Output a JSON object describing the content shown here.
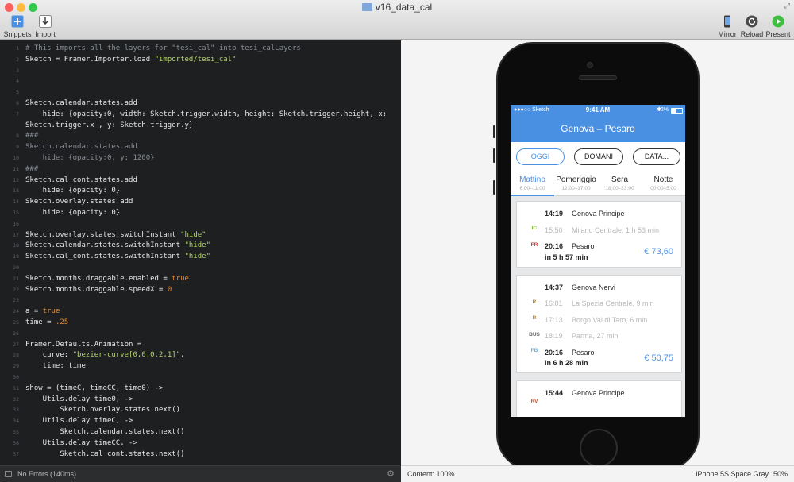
{
  "window": {
    "title": "v16_data_cal",
    "traffic_colors": [
      "#fc605c",
      "#fdbc40",
      "#34c84a"
    ]
  },
  "toolbar": {
    "snippets_label": "Snippets",
    "import_label": "Import",
    "mirror_label": "Mirror",
    "reload_label": "Reload",
    "present_label": "Present"
  },
  "editor": {
    "lines": [
      {
        "no": "1",
        "tokens": [
          {
            "t": "# This imports all the layers for \"tesi_cal\" into tesi_calLayers",
            "c": "cmt"
          }
        ]
      },
      {
        "no": "2",
        "tokens": [
          {
            "t": "Sketch = Framer.Importer.load ",
            "c": ""
          },
          {
            "t": "\"imported/tesi_cal\"",
            "c": "str"
          }
        ]
      },
      {
        "no": "3",
        "tokens": []
      },
      {
        "no": "4",
        "tokens": []
      },
      {
        "no": "5",
        "tokens": []
      },
      {
        "no": "6",
        "tokens": [
          {
            "t": "Sketch.calendar.states.add",
            "c": ""
          }
        ]
      },
      {
        "no": "7",
        "tokens": [
          {
            "t": "    hide: {opacity:0, width: Sketch.trigger.width, height: Sketch.trigger.height, x:",
            "c": ""
          }
        ]
      },
      {
        "no": "",
        "tokens": [
          {
            "t": "Sketch.trigger.x , y: Sketch.trigger.y}",
            "c": ""
          }
        ]
      },
      {
        "no": "8",
        "tokens": [
          {
            "t": "###",
            "c": "cmt"
          }
        ]
      },
      {
        "no": "9",
        "tokens": [
          {
            "t": "Sketch.calendar.states.add",
            "c": "cmt"
          }
        ]
      },
      {
        "no": "10",
        "tokens": [
          {
            "t": "    hide: {opacity:0, y: 1200}",
            "c": "cmt"
          }
        ]
      },
      {
        "no": "11",
        "tokens": [
          {
            "t": "###",
            "c": "cmt"
          }
        ]
      },
      {
        "no": "12",
        "tokens": [
          {
            "t": "Sketch.cal_cont.states.add",
            "c": ""
          }
        ]
      },
      {
        "no": "13",
        "tokens": [
          {
            "t": "    hide: {opacity: 0}",
            "c": ""
          }
        ]
      },
      {
        "no": "14",
        "tokens": [
          {
            "t": "Sketch.overlay.states.add",
            "c": ""
          }
        ]
      },
      {
        "no": "15",
        "tokens": [
          {
            "t": "    hide: {opacity: 0}",
            "c": ""
          }
        ]
      },
      {
        "no": "16",
        "tokens": []
      },
      {
        "no": "17",
        "tokens": [
          {
            "t": "Sketch.overlay.states.switchInstant ",
            "c": ""
          },
          {
            "t": "\"hide\"",
            "c": "str"
          }
        ]
      },
      {
        "no": "18",
        "tokens": [
          {
            "t": "Sketch.calendar.states.switchInstant ",
            "c": ""
          },
          {
            "t": "\"hide\"",
            "c": "str"
          }
        ]
      },
      {
        "no": "19",
        "tokens": [
          {
            "t": "Sketch.cal_cont.states.switchInstant ",
            "c": ""
          },
          {
            "t": "\"hide\"",
            "c": "str"
          }
        ]
      },
      {
        "no": "20",
        "tokens": []
      },
      {
        "no": "21",
        "tokens": [
          {
            "t": "Sketch.months.draggable.enabled = ",
            "c": ""
          },
          {
            "t": "true",
            "c": "kw"
          }
        ]
      },
      {
        "no": "22",
        "tokens": [
          {
            "t": "Sketch.months.draggable.speedX = ",
            "c": ""
          },
          {
            "t": "0",
            "c": "kw"
          }
        ]
      },
      {
        "no": "23",
        "tokens": []
      },
      {
        "no": "24",
        "tokens": [
          {
            "t": "a = ",
            "c": ""
          },
          {
            "t": "true",
            "c": "kw"
          }
        ]
      },
      {
        "no": "25",
        "tokens": [
          {
            "t": "time = ",
            "c": ""
          },
          {
            "t": ".25",
            "c": "kw"
          }
        ]
      },
      {
        "no": "26",
        "tokens": []
      },
      {
        "no": "27",
        "tokens": [
          {
            "t": "Framer.Defaults.Animation =",
            "c": ""
          }
        ]
      },
      {
        "no": "28",
        "tokens": [
          {
            "t": "    curve: ",
            "c": ""
          },
          {
            "t": "\"bezier-curve[0,0,0.2,1]\"",
            "c": "str"
          },
          {
            "t": ",",
            "c": ""
          }
        ]
      },
      {
        "no": "29",
        "tokens": [
          {
            "t": "    time: time",
            "c": ""
          }
        ]
      },
      {
        "no": "30",
        "tokens": []
      },
      {
        "no": "31",
        "tokens": [
          {
            "t": "show = (timeC, timeCC, time0) ->",
            "c": ""
          }
        ]
      },
      {
        "no": "32",
        "tokens": [
          {
            "t": "    Utils.delay time0, ->",
            "c": ""
          }
        ]
      },
      {
        "no": "33",
        "tokens": [
          {
            "t": "        Sketch.overlay.states.next()",
            "c": ""
          }
        ]
      },
      {
        "no": "34",
        "tokens": [
          {
            "t": "    Utils.delay timeC, ->",
            "c": ""
          }
        ]
      },
      {
        "no": "35",
        "tokens": [
          {
            "t": "        Sketch.calendar.states.next()",
            "c": ""
          }
        ]
      },
      {
        "no": "36",
        "tokens": [
          {
            "t": "    Utils.delay timeCC, ->",
            "c": ""
          }
        ]
      },
      {
        "no": "37",
        "tokens": [
          {
            "t": "        Sketch.cal_cont.states.next()",
            "c": ""
          }
        ]
      }
    ],
    "status": "No Errors (140ms)"
  },
  "preview": {
    "content_zoom": "Content: 100%",
    "device": "iPhone 5S Space Gray",
    "device_zoom": "50%"
  },
  "app": {
    "status_bar": {
      "carrier": "●●●○○ Sketch",
      "time": "9:41 AM",
      "battery": "42%"
    },
    "route_title": "Genova – Pesaro",
    "day_buttons": [
      "OGGI",
      "DOMANI",
      "DATA..."
    ],
    "time_tabs": [
      {
        "name": "Mattino",
        "time": "6:00–11:00"
      },
      {
        "name": "Pomeriggio",
        "time": "12:00–17:00"
      },
      {
        "name": "Sera",
        "time": "18:00–23:00"
      },
      {
        "name": "Notte",
        "time": "00:00–5:00"
      }
    ],
    "accent_color": "#4a90e2",
    "trips": [
      {
        "tags": [
          "IC",
          "FR"
        ],
        "stops": [
          {
            "time": "14:19",
            "station": "Genova Principe",
            "via": false
          },
          {
            "time": "15:50",
            "station": "Milano Centrale, 1 h 53 min",
            "via": true
          },
          {
            "time": "20:16",
            "station": "Pesaro",
            "via": false
          }
        ],
        "duration": "in 5 h 57 min",
        "price": "€ 73,60"
      },
      {
        "tags": [
          "R",
          "R",
          "BUS",
          "FB"
        ],
        "stops": [
          {
            "time": "14:37",
            "station": "Genova Nervi",
            "via": false
          },
          {
            "time": "16:01",
            "station": "La Spezia Centrale, 9 min",
            "via": true
          },
          {
            "time": "17:13",
            "station": "Borgo Val di Taro, 6 min",
            "via": true
          },
          {
            "time": "18:19",
            "station": "Parma, 27 min",
            "via": true
          },
          {
            "time": "20:16",
            "station": "Pesaro",
            "via": false
          }
        ],
        "duration": "in 6 h 28 min",
        "price": "€ 50,75"
      },
      {
        "tags": [
          "RV"
        ],
        "stops": [
          {
            "time": "15:44",
            "station": "Genova Principe",
            "via": false
          }
        ],
        "duration": "",
        "price": ""
      }
    ]
  }
}
